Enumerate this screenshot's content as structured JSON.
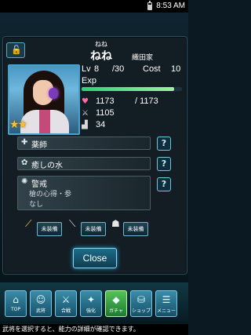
{
  "status_bar": {
    "time": "8:53 AM",
    "battery_icon": "battery-icon"
  },
  "header": {
    "lock_icon": "unlock-icon"
  },
  "general": {
    "furigana": "ねね",
    "name": "ねね",
    "clan": "織田家",
    "rarity_stars": 2,
    "level_label": "Lv",
    "level": "8",
    "level_max": "/30",
    "cost_label": "Cost",
    "cost": "10",
    "exp_label": "Exp",
    "exp_fraction": 0.92,
    "hp": "1173",
    "hp_max": "/ 1173",
    "attack": "1105",
    "speed": "34"
  },
  "skills": [
    {
      "icon": "heal-icon",
      "name": "薬師",
      "help": "?"
    },
    {
      "icon": "gear-icon",
      "name": "癒しの水",
      "help": "?"
    },
    {
      "icon": "trait-icon",
      "name": "警戒",
      "help": "?",
      "line1": "槍の心得・参",
      "line2": "なし"
    }
  ],
  "equipment": [
    {
      "icon": "spear-icon",
      "label": "未装備"
    },
    {
      "icon": "sword-icon",
      "label": "未装備"
    },
    {
      "icon": "helmet-icon",
      "label": "未装備"
    }
  ],
  "close_label": "Close",
  "tabs": [
    {
      "icon": "home-icon",
      "label": "TOP"
    },
    {
      "icon": "general-icon",
      "label": "武将"
    },
    {
      "icon": "battle-icon",
      "label": "合戦"
    },
    {
      "icon": "upgrade-icon",
      "label": "強化"
    },
    {
      "icon": "gacha-icon",
      "label": "ガチャ"
    },
    {
      "icon": "shop-icon",
      "label": "ショップ"
    },
    {
      "icon": "menu-icon",
      "label": "メニュー"
    }
  ],
  "footer_text": "武将を選択すると、能力の詳細が確認できます。"
}
